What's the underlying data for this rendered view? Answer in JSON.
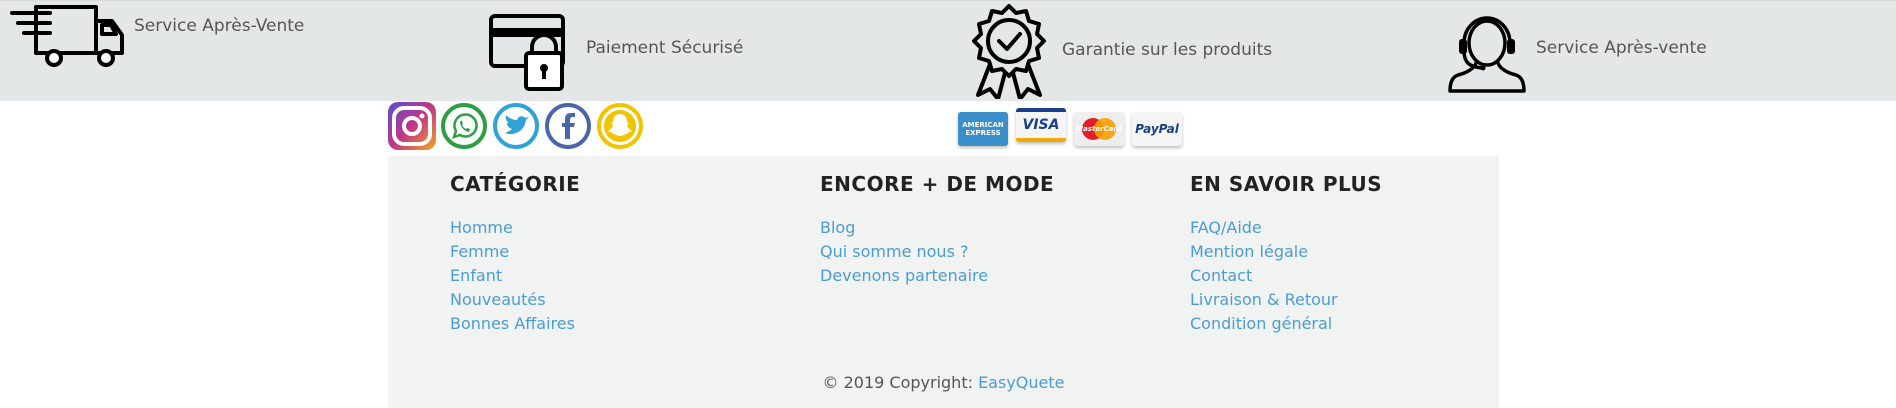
{
  "features": [
    {
      "label": "Service Après-Vente",
      "icon": "delivery-truck-icon"
    },
    {
      "label": "Paiement Sécurisé",
      "icon": "secure-card-lock-icon"
    },
    {
      "label": "Garantie sur les produits",
      "icon": "award-badge-icon"
    },
    {
      "label": "Service Après-vente",
      "icon": "headset-support-icon"
    }
  ],
  "social": [
    {
      "name": "instagram",
      "icon": "instagram-icon",
      "color": "#c13584"
    },
    {
      "name": "whatsapp",
      "icon": "whatsapp-icon",
      "color": "#2e9e44"
    },
    {
      "name": "twitter",
      "icon": "twitter-icon",
      "color": "#2fa3d9"
    },
    {
      "name": "facebook",
      "icon": "facebook-icon",
      "color": "#4a66a8"
    },
    {
      "name": "snapchat",
      "icon": "snapchat-icon",
      "color": "#f2c400"
    }
  ],
  "payments": {
    "amex": "AMERICAN EXPRESS",
    "visa": "VISA",
    "mastercard": "MasterCard",
    "paypal": "PayPal"
  },
  "columns": [
    {
      "title": "CATÉGORIE",
      "links": [
        "Homme",
        "Femme",
        "Enfant",
        "Nouveautés",
        "Bonnes Affaires"
      ]
    },
    {
      "title": "ENCORE + DE MODE",
      "links": [
        "Blog",
        "Qui somme nous ?",
        "Devenons partenaire"
      ]
    },
    {
      "title": "EN SAVOIR PLUS",
      "links": [
        "FAQ/Aide",
        "Mention légale",
        "Contact",
        "Livraison & Retour",
        "Condition général"
      ]
    }
  ],
  "copyright": {
    "text": "© 2019 Copyright: ",
    "brand": "EasyQuete"
  },
  "colors": {
    "link": "#4b9cd3",
    "feature_bar": "#e4e7e8",
    "footer_bg": "#f1f3f2"
  }
}
